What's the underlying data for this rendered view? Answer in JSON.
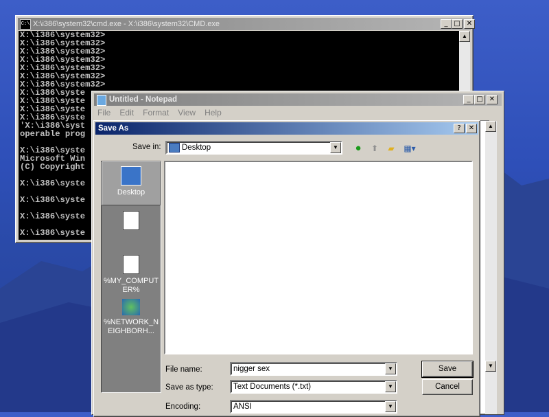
{
  "cmd": {
    "title": "X:\\i386\\system32\\cmd.exe - X:\\i386\\system32\\CMD.exe",
    "icon_text": "C:\\",
    "lines": [
      "X:\\i386\\system32>",
      "X:\\i386\\system32>",
      "X:\\i386\\system32>",
      "X:\\i386\\system32>",
      "X:\\i386\\system32>",
      "X:\\i386\\system32>",
      "X:\\i386\\system32>",
      "X:\\i386\\syste",
      "X:\\i386\\syste",
      "X:\\i386\\syste",
      "X:\\i386\\syste",
      "'X:\\i386\\syst",
      "operable prog",
      "",
      "X:\\i386\\syste",
      "Microsoft Win",
      "(C) Copyright",
      "",
      "X:\\i386\\syste",
      "",
      "X:\\i386\\syste",
      "",
      "X:\\i386\\syste",
      "",
      "X:\\i386\\syste"
    ]
  },
  "notepad": {
    "title": "Untitled - Notepad",
    "menu": [
      "File",
      "Edit",
      "Format",
      "View",
      "Help"
    ]
  },
  "dialog": {
    "title": "Save As",
    "save_in_label": "Save in:",
    "save_in_value": "Desktop",
    "places": [
      "Desktop",
      "",
      "%MY_COMPUTER%",
      "%NETWORK_NEIGHBORH..."
    ],
    "file_name_label": "File name:",
    "file_name_value": "nigger sex",
    "save_as_type_label": "Save as type:",
    "save_as_type_value": "Text Documents (*.txt)",
    "encoding_label": "Encoding:",
    "encoding_value": "ANSI",
    "save_button": "Save",
    "cancel_button": "Cancel"
  },
  "caption_glyphs": {
    "minimize": "_",
    "maximize": "□",
    "close": "✕",
    "help": "?"
  },
  "icons": [
    "cmd-icon",
    "notepad-icon",
    "desktop-icon",
    "back-icon",
    "up-folder-icon",
    "new-folder-icon",
    "views-menu-icon",
    "document-icon",
    "computer-icon",
    "network-icon"
  ],
  "colors": {
    "dialog_title": "#0a246a",
    "inactive_title": "#808080",
    "face": "#d4d0c8"
  }
}
